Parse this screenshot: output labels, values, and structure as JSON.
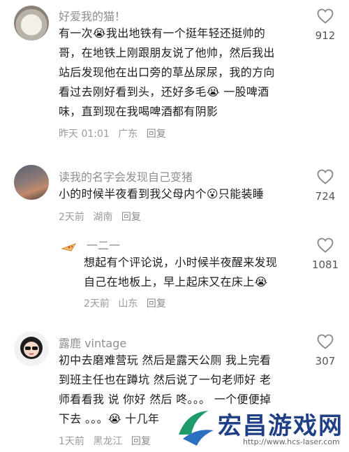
{
  "comments": [
    {
      "username": "好爱我的猫！",
      "lines": [
        "有一次😭我出地铁有一个挺年轻还挺帅的",
        "哥，在地铁上刚跟朋友说了他帅，然后我出",
        "站后发现他在出口旁的草丛尿尿，我的方向",
        "看过去刚好看到头，还好多毛😭 一股啤酒",
        "味，直到现在我喝啤酒都有阴影"
      ],
      "time": "昨天 01:01",
      "location": "广东",
      "reply": "回复",
      "likes": "912"
    },
    {
      "username": "读我的名字会发现自己变猪",
      "lines": [
        "小的时候半夜看到我父母内个😮只能装睡"
      ],
      "time": "2天前",
      "location": "湖南",
      "reply": "回复",
      "likes": "724"
    },
    {
      "username": "一二一",
      "lines": [
        "想起有个评论说，小时候半夜醒来发现",
        "自己在地板上，早上起床又在床上😭"
      ],
      "time": "2天前",
      "location": "山东",
      "reply": "回复",
      "likes": "1081"
    },
    {
      "username": "露鹿 vintage",
      "lines": [
        "初中去磨难营玩  然后是露天公厕  我上完看",
        "到班主任也在蹲坑  然后说了一句老师好  老",
        "师看看我 说 你好 然后 咚。。。 一个便便掉",
        "下去  。。。😭 十几年"
      ],
      "time": "1天前",
      "location": "黑龙江",
      "reply": "回复",
      "likes": "307"
    }
  ],
  "watermark": {
    "brand": "宏昌游戏网",
    "url": "http://www.hcs-laser.com"
  }
}
